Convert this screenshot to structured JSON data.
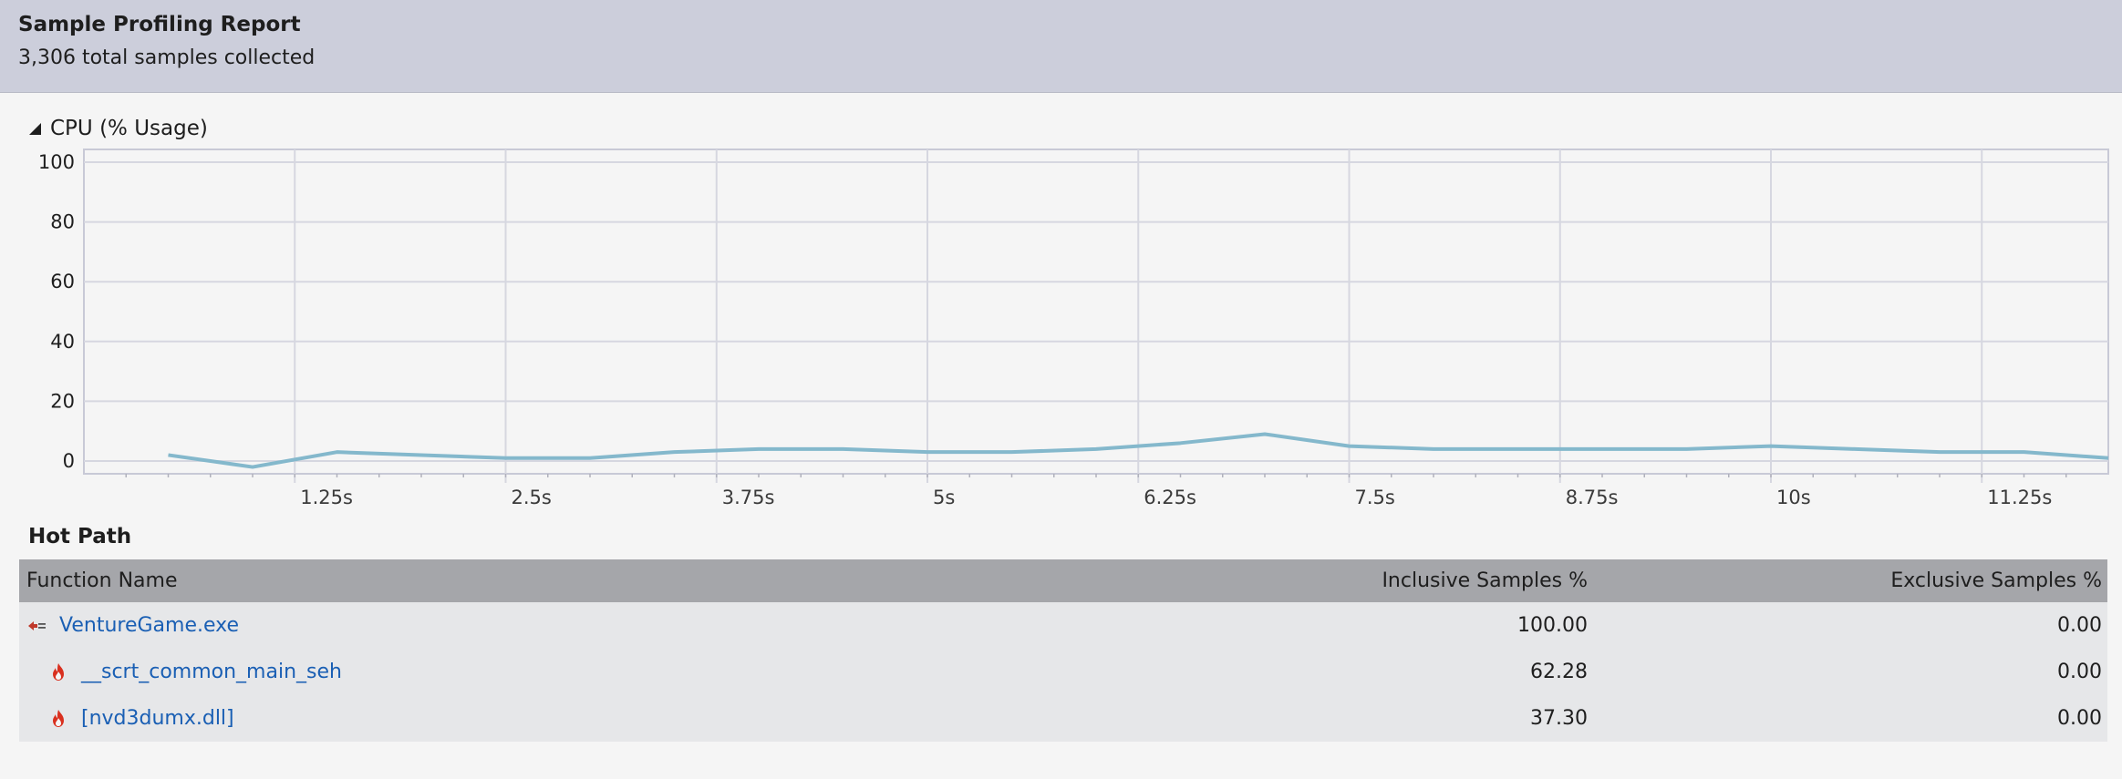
{
  "report": {
    "title": "Sample Profiling Report",
    "subtitle": "3,306 total samples collected"
  },
  "cpu_section": {
    "label": "CPU (% Usage)"
  },
  "chart_data": {
    "type": "line",
    "title": "CPU (% Usage)",
    "xlabel": "",
    "ylabel": "",
    "ylim": [
      0,
      100
    ],
    "xlim": [
      0,
      12
    ],
    "y_ticks": [
      "0",
      "20",
      "40",
      "60",
      "80",
      "100"
    ],
    "x_ticks": [
      "1.25s",
      "2.5s",
      "3.75s",
      "5s",
      "6.25s",
      "7.5s",
      "8.75s",
      "10s",
      "11.25s"
    ],
    "x_tick_values": [
      1.25,
      2.5,
      3.75,
      5,
      6.25,
      7.5,
      8.75,
      10,
      11.25
    ],
    "grid": true,
    "line_color": "#84b8cc",
    "series": [
      {
        "x": [
          0.5,
          1.0,
          1.5,
          2.0,
          2.5,
          3.0,
          3.5,
          4.0,
          4.5,
          5.0,
          5.5,
          6.0,
          6.5,
          7.0,
          7.5,
          8.0,
          8.5,
          9.0,
          9.5,
          10.0,
          10.5,
          11.0,
          11.5,
          12.0
        ],
        "y": [
          2,
          -2,
          3,
          2,
          1,
          1,
          3,
          4,
          4,
          3,
          3,
          4,
          6,
          9,
          5,
          4,
          4,
          4,
          4,
          5,
          4,
          3,
          3,
          1
        ]
      }
    ]
  },
  "hot_path": {
    "label": "Hot Path",
    "columns": {
      "name": "Function Name",
      "inclusive": "Inclusive Samples %",
      "exclusive": "Exclusive Samples %"
    },
    "rows": [
      {
        "name": "VentureGame.exe",
        "inclusive": "100.00",
        "exclusive": "0.00",
        "icon": "process-icon"
      },
      {
        "name": "__scrt_common_main_seh",
        "inclusive": "62.28",
        "exclusive": "0.00",
        "icon": "hot-flame-icon"
      },
      {
        "name": "[nvd3dumx.dll]",
        "inclusive": "37.30",
        "exclusive": "0.00",
        "icon": "hot-flame-icon"
      }
    ]
  }
}
